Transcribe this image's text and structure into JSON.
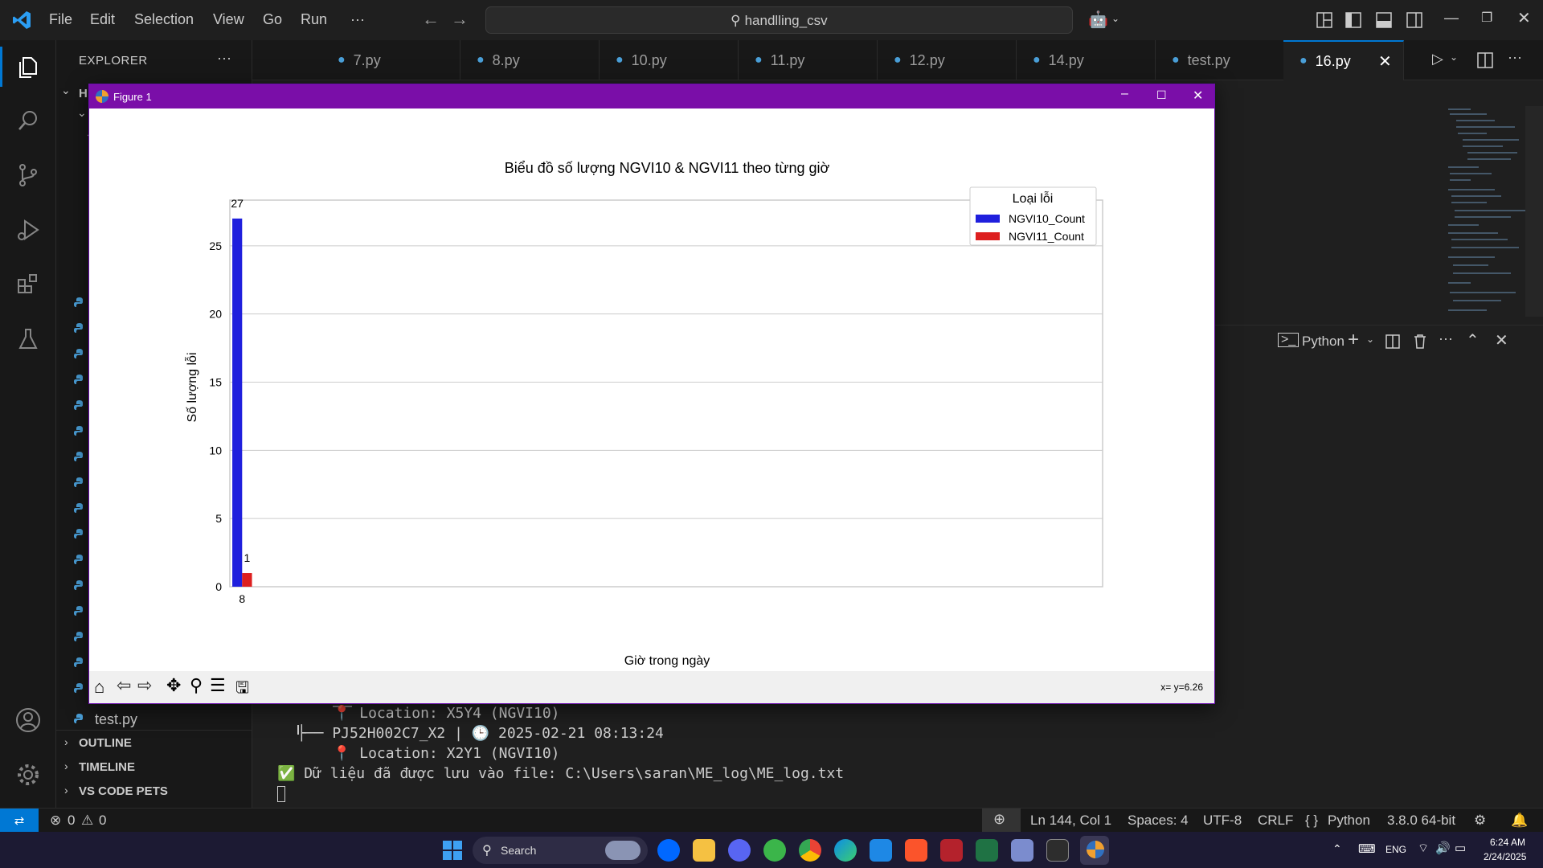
{
  "menu": {
    "file": "File",
    "edit": "Edit",
    "selection": "Selection",
    "view": "View",
    "go": "Go",
    "run": "Run",
    "more": "···"
  },
  "search_box": {
    "text": "handlling_csv"
  },
  "sidebar": {
    "title": "EXPLORER",
    "more": "···",
    "folder_initial": "H",
    "file_visible": "test.py",
    "outline": "OUTLINE",
    "timeline": "TIMELINE",
    "pets": "VS CODE PETS"
  },
  "tabs": [
    {
      "label": "7.py"
    },
    {
      "label": "8.py"
    },
    {
      "label": "10.py"
    },
    {
      "label": "11.py"
    },
    {
      "label": "12.py"
    },
    {
      "label": "14.py"
    },
    {
      "label": "test.py"
    },
    {
      "label": "16.py"
    }
  ],
  "terminal": {
    "profile": "Python",
    "lines": [
      "📍 Location: X5Y4 (NGVI10)",
      "├── PJ52H002C7_X2 | 🕒 2025-02-21 08:13:24",
      "📍 Location: X2Y1 (NGVI10)",
      "✅ Dữ liệu đã được lưu vào file: C:\\Users\\saran\\ME_log\\ME_log.txt"
    ]
  },
  "statusbar": {
    "errors": "0",
    "warnings": "0",
    "position": "Ln 144, Col 1",
    "spaces": "Spaces: 4",
    "encoding": "UTF-8",
    "eol": "CRLF",
    "language": "Python",
    "interpreter": "3.8.0 64-bit"
  },
  "taskbar": {
    "search": "Search",
    "lang": "ENG",
    "time": "6:24 AM",
    "date": "2/24/2025"
  },
  "figure": {
    "window_title": "Figure 1",
    "coords": "x= y=6.26"
  },
  "chart_data": {
    "type": "bar",
    "title": "Biểu đồ số lượng NGVI10 & NGVI11 theo từng giờ",
    "xlabel": "Giờ trong ngày",
    "ylabel": "Số lượng lỗi",
    "categories": [
      "8"
    ],
    "series": [
      {
        "name": "NGVI10_Count",
        "values": [
          27
        ],
        "color": "#1f1fdd"
      },
      {
        "name": "NGVI11_Count",
        "values": [
          1
        ],
        "color": "#dd1f1f"
      }
    ],
    "ylim": [
      0,
      28.35
    ],
    "xlim": [
      -0.5,
      35
    ],
    "yticks": [
      0,
      5,
      10,
      15,
      20,
      25
    ],
    "grid": "y",
    "legend_title": "Loại lỗi",
    "legend_position": "top-right",
    "data_labels": true
  },
  "colors": {
    "accent": "#0078d4",
    "figure_titlebar": "#7a0ea8",
    "editor_bg": "#1f1f1f"
  }
}
